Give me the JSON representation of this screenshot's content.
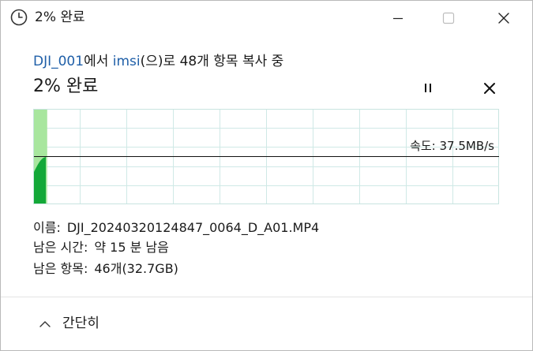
{
  "window": {
    "title": "2% 완료",
    "icon": "clock-icon"
  },
  "copy": {
    "source_name": "DJI_001",
    "part1": "에서 ",
    "dest_name": "imsi",
    "part2": "(으)로 48개 항목 복사 중",
    "headline": "2% 완료",
    "progress_percent": 2,
    "speed_label": "속도: 37.5MB/s"
  },
  "details": {
    "name_label": "이름:",
    "name_value": "DJI_20240320124847_0064_D_A01.MP4",
    "time_label": "남은 시간:",
    "time_value": "약 15 분 남음",
    "items_label": "남은 항목:",
    "items_value": "46개(32.7GB)"
  },
  "footer": {
    "collapse_label": "간단히"
  },
  "colors": {
    "accent_green": "#13a838",
    "light_green": "#a8e69e",
    "grid_line": "#cfe9e6",
    "link_blue": "#1f5fa8"
  }
}
